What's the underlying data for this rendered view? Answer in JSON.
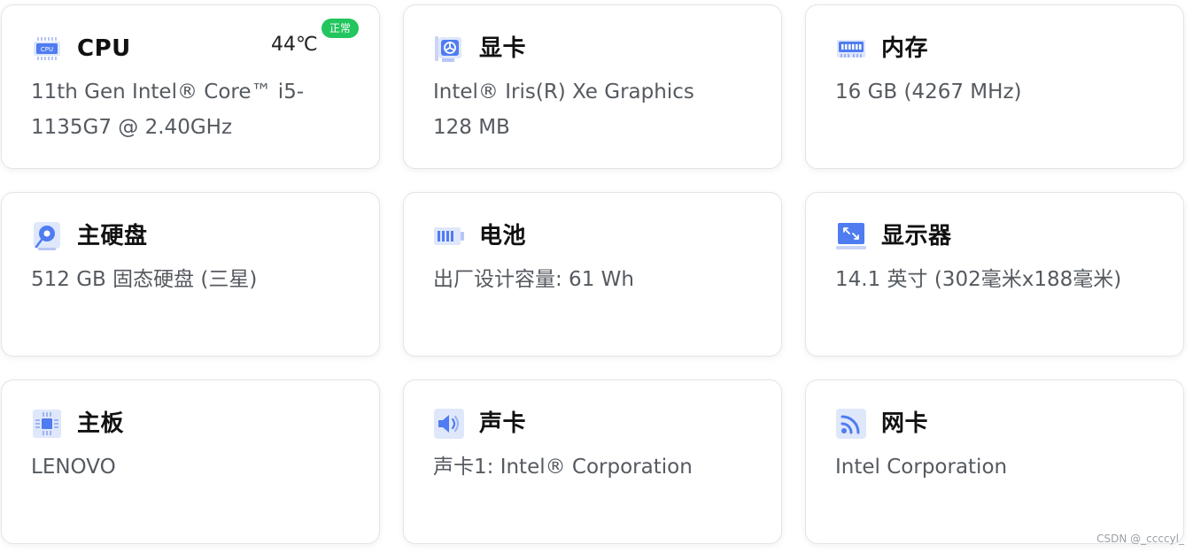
{
  "cards": [
    {
      "icon": "cpu-chip-icon",
      "title": "CPU",
      "desc": "11th Gen Intel® Core™ i5-1135G7 @ 2.40GHz",
      "temperature": "44℃",
      "status": "正常"
    },
    {
      "icon": "graphics-card-icon",
      "title": "显卡",
      "desc": "Intel® Iris(R) Xe Graphics 128 MB"
    },
    {
      "icon": "memory-module-icon",
      "title": "内存",
      "desc": "16 GB (4267 MHz)"
    },
    {
      "icon": "hard-disk-icon",
      "title": "主硬盘",
      "desc": "512 GB 固态硬盘 (三星)"
    },
    {
      "icon": "battery-icon",
      "title": "电池",
      "desc": "出厂设计容量: 61 Wh"
    },
    {
      "icon": "monitor-icon",
      "title": "显示器",
      "desc": "14.1 英寸 (302毫米x188毫米)"
    },
    {
      "icon": "motherboard-icon",
      "title": "主板",
      "desc": "LENOVO"
    },
    {
      "icon": "speaker-icon",
      "title": "声卡",
      "desc": "声卡1: Intel® Corporation"
    },
    {
      "icon": "network-icon",
      "title": "网卡",
      "desc": "Intel Corporation"
    }
  ],
  "icon_cpu_label": "CPU",
  "watermark": "CSDN @_ccccyl_",
  "colors": {
    "accent": "#4f7cf0",
    "status_ok": "#22c55e"
  }
}
